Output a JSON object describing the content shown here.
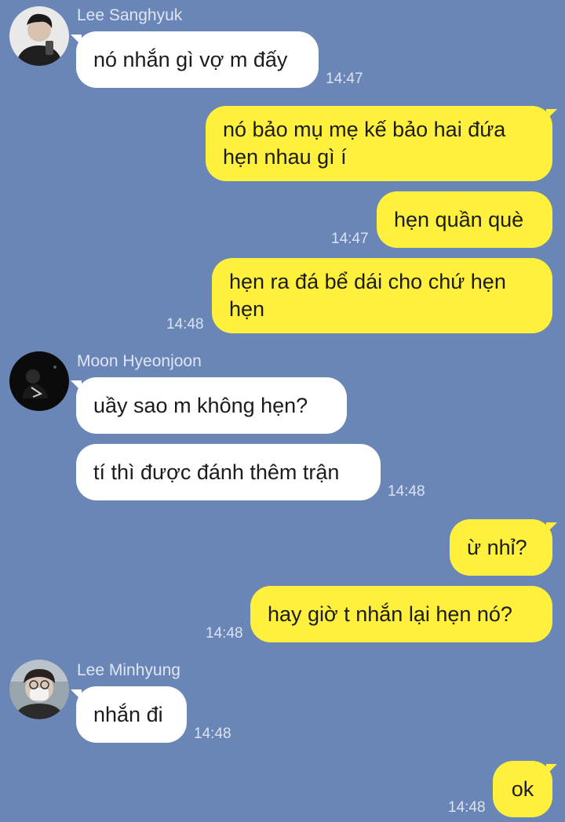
{
  "messages": {
    "m1": {
      "sender": "Lee Sanghyuk",
      "text": "nó nhắn gì vợ m đấy",
      "time": "14:47"
    },
    "m2": {
      "text_line1": "nó bảo mụ mẹ kế bảo hai đứa",
      "text_line2": "hẹn nhau gì í"
    },
    "m3": {
      "text": "hẹn quần què",
      "time": "14:47"
    },
    "m4": {
      "text_line1": "hẹn ra đá bể dái cho chứ hẹn",
      "text_line2": "hẹn",
      "time": "14:48"
    },
    "m5": {
      "sender": "Moon Hyeonjoon",
      "text": "uầy sao m không hẹn?"
    },
    "m6": {
      "text": "tí thì được đánh thêm trận",
      "time": "14:48"
    },
    "m7": {
      "text": "ừ nhỉ?"
    },
    "m8": {
      "text": "hay giờ t nhắn lại hẹn nó?",
      "time": "14:48"
    },
    "m9": {
      "sender": "Lee Minhyung",
      "text": "nhắn đi",
      "time": "14:48"
    },
    "m10": {
      "text": "ok",
      "time": "14:48"
    }
  },
  "colors": {
    "background": "#6a86b6",
    "incoming_bubble": "#ffffff",
    "outgoing_bubble": "#fef03c",
    "sender_name": "#dfe6f3",
    "timestamp": "#dbe3f1"
  },
  "icons": {
    "avatar_1": "avatar-photo-lee-sanghyuk",
    "avatar_2": "avatar-photo-moon-hyeonjoon",
    "avatar_3": "avatar-photo-lee-minhyung"
  }
}
